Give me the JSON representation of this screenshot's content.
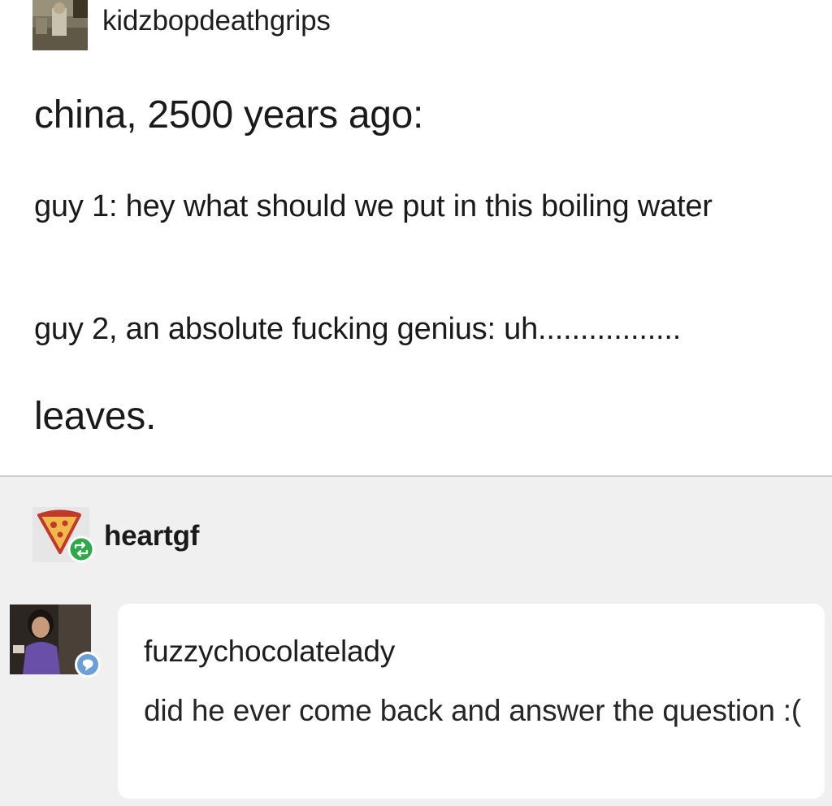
{
  "post": {
    "username": "kidzbopdeathgrips",
    "title": "china, 2500 years ago:",
    "line1": "guy 1: hey what should we put in this boiling water",
    "line2": "guy 2, an absolute fucking genius: uh.................",
    "line3": "leaves."
  },
  "reblog": {
    "username": "heartgf",
    "reblog_icon": "reblog-icon"
  },
  "comment": {
    "username": "fuzzychocolatelady",
    "text": "did he ever come back and answer the question :(",
    "badge_icon": "chat-bubble-icon"
  },
  "colors": {
    "reblog_badge": "#2fa84a",
    "comment_badge": "#6a9fd8",
    "background_gray": "#f0f0f0"
  }
}
